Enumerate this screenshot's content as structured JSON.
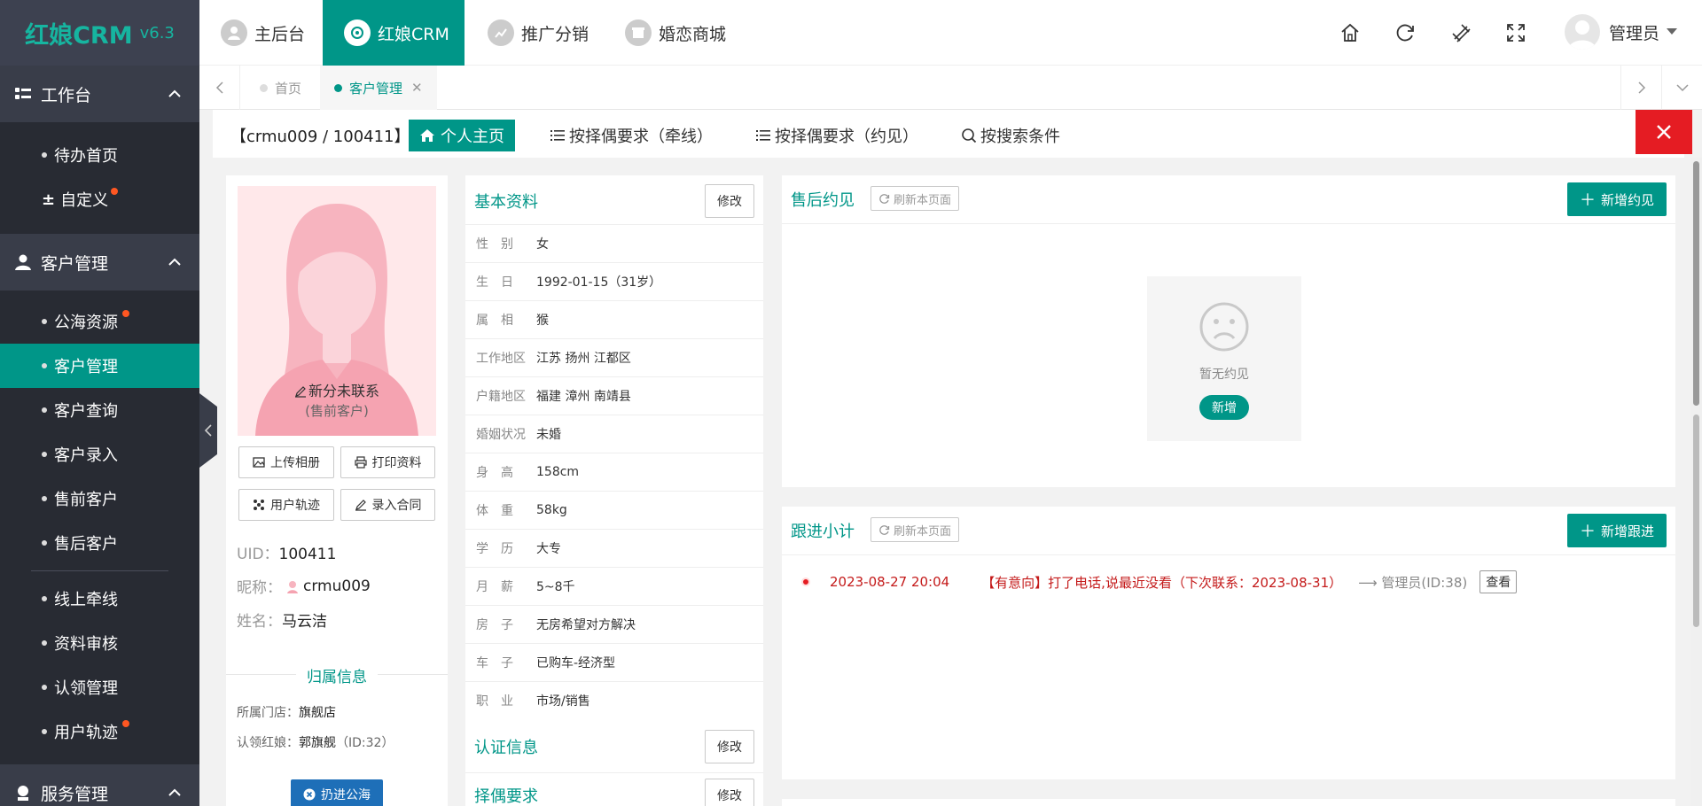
{
  "app": {
    "name": "红娘CRM",
    "version": "v6.3"
  },
  "sidebar": {
    "groups": [
      {
        "title": "工作台",
        "items": [
          {
            "label": "待办首页"
          },
          {
            "label": "自定义"
          }
        ]
      },
      {
        "title": "客户管理",
        "items": [
          {
            "label": "公海资源"
          },
          {
            "label": "客户管理"
          },
          {
            "label": "客户查询"
          },
          {
            "label": "客户录入"
          },
          {
            "label": "售前客户"
          },
          {
            "label": "售后客户"
          },
          {
            "label": "线上牵线"
          },
          {
            "label": "资料审核"
          },
          {
            "label": "认领管理"
          },
          {
            "label": "用户轨迹"
          }
        ]
      },
      {
        "title": "服务管理"
      }
    ]
  },
  "topnav": [
    {
      "label": "主后台"
    },
    {
      "label": "红娘CRM"
    },
    {
      "label": "推广分销"
    },
    {
      "label": "婚恋商城"
    }
  ],
  "admin": {
    "name": "管理员"
  },
  "tabs": [
    {
      "label": "首页"
    },
    {
      "label": "客户管理"
    }
  ],
  "subbar": {
    "user_id": "【crmu009 / 100411】",
    "buttons": [
      {
        "label": "个人主页"
      },
      {
        "label": "按择偶要求（牵线）"
      },
      {
        "label": "按择偶要求（约见）"
      },
      {
        "label": "按搜索条件"
      }
    ]
  },
  "profile": {
    "status": "新分未联系",
    "sub_status": "(售前客户)",
    "buttons": [
      {
        "label": "上传相册"
      },
      {
        "label": "打印资料"
      },
      {
        "label": "用户轨迹"
      },
      {
        "label": "录入合同"
      }
    ],
    "uid_label": "UID：",
    "uid": "100411",
    "nick_label": "昵称：",
    "nick": "crmu009",
    "name_label": "姓名：",
    "name": "马云洁",
    "belong_title": "归属信息",
    "store_label": "所属门店：",
    "store": "旗舰店",
    "matchmaker_label": "认领红娘：",
    "matchmaker": "郭旗舰",
    "matchmaker_id": "（ID:32）",
    "sea_button": "扔进公海"
  },
  "basic": {
    "title": "基本资料",
    "edit": "修改",
    "rows": [
      {
        "label": "性　别",
        "value": "女"
      },
      {
        "label": "生　日",
        "value": "1992-01-15（31岁）"
      },
      {
        "label": "属　相",
        "value": "猴"
      },
      {
        "label": "工作地区",
        "value": "江苏 扬州 江都区"
      },
      {
        "label": "户籍地区",
        "value": "福建 漳州 南靖县"
      },
      {
        "label": "婚姻状况",
        "value": "未婚"
      },
      {
        "label": "身　高",
        "value": "158cm"
      },
      {
        "label": "体　重",
        "value": "58kg"
      },
      {
        "label": "学　历",
        "value": "大专"
      },
      {
        "label": "月　薪",
        "value": "5~8千"
      },
      {
        "label": "房　子",
        "value": "无房希望对方解决"
      },
      {
        "label": "车　子",
        "value": "已购车-经济型"
      },
      {
        "label": "职　业",
        "value": "市场/销售"
      }
    ],
    "cert_title": "认证信息",
    "cert_edit": "修改",
    "req_title": "择偶要求",
    "req_edit": "修改"
  },
  "meeting": {
    "title": "售后约见",
    "refresh": "刷新本页面",
    "add": "新增约见",
    "empty_text": "暂无约见",
    "empty_btn": "新增"
  },
  "follow": {
    "title": "跟进小计",
    "refresh": "刷新本页面",
    "add": "新增跟进",
    "records": [
      {
        "time": "2023-08-27 20:04",
        "content": "【有意向】打了电话,说最近没看（下次联系：2023-08-31）",
        "by": "⟶ 管理员(ID:38)",
        "view": "查看"
      }
    ]
  },
  "colors": {
    "accent": "#009688",
    "sidebar": "#393D49",
    "danger": "#e51c23",
    "badge": "#ff5722"
  }
}
